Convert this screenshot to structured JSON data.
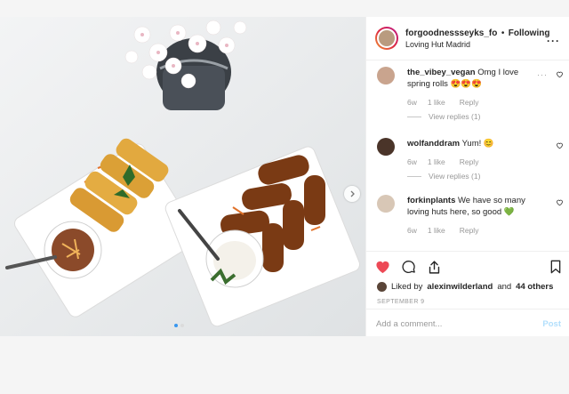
{
  "colors": {
    "accent": "#3897f0",
    "like_red": "#ed4956",
    "muted": "#999999",
    "post_disabled": "#b2dffc"
  },
  "header": {
    "username": "forgoodnessseyks_fo",
    "separator": "•",
    "follow_label": "Following",
    "location": "Loving Hut Madrid",
    "more_icon": "more-horizontal-icon"
  },
  "comments": [
    {
      "username": "the_vibey_vegan",
      "text": "Omg I love spring rolls 😍😍😍",
      "age": "6w",
      "likes": "1 like",
      "reply_label": "Reply",
      "view_replies": "View replies (1)"
    },
    {
      "username": "wolfanddram",
      "text": "Yum! 😊",
      "age": "6w",
      "likes": "1 like",
      "reply_label": "Reply",
      "view_replies": "View replies (1)"
    },
    {
      "username": "forkinplants",
      "text": "We have so many loving huts here, so good 💚",
      "age": "6w",
      "likes": "1 like",
      "reply_label": "Reply"
    }
  ],
  "actions": {
    "like_icon": "heart-filled-icon",
    "comment_icon": "comment-bubble-icon",
    "share_icon": "share-icon",
    "save_icon": "bookmark-icon"
  },
  "likes": {
    "prefix": "Liked by",
    "user": "alexinwilderland",
    "conjunction": "and",
    "others": "44 others"
  },
  "date": "SEPTEMBER 9",
  "add_comment": {
    "placeholder": "Add a comment...",
    "post_label": "Post"
  },
  "carousel": {
    "current": 1,
    "total": 2
  }
}
